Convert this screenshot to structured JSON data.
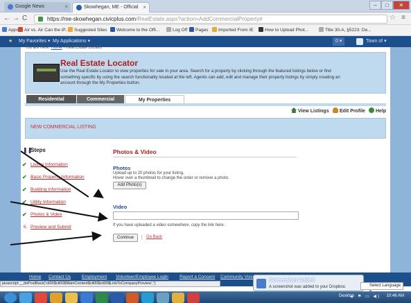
{
  "browser": {
    "tabs": [
      {
        "label": "Google News",
        "color": "#4a7bd0"
      },
      {
        "label": "Skowhegan, ME - Official",
        "color": "#2d5aa8"
      }
    ],
    "window_buttons": [
      "–",
      "□",
      "✕"
    ],
    "url_host": "https://me-skowhegan.civicplus.com",
    "url_path": "/RealEstate.aspx?action=AddCommercialProperty#",
    "bookmarks": [
      {
        "label": "Apps",
        "color": "#4a7bd0"
      },
      {
        "label": "Air vs. Air Can the iP...",
        "color": "#d04a2a"
      },
      {
        "label": "Suggested Sites",
        "color": "#f0a830"
      },
      {
        "label": "Welcome to the Offi...",
        "color": "#2d5aa8"
      },
      {
        "label": "Log Off",
        "color": "#888888"
      },
      {
        "label": "Pages",
        "color": "#2d5aa8"
      },
      {
        "label": "Imported From IE",
        "color": "#e0b030"
      },
      {
        "label": "How to Upload Phot...",
        "color": "#333333"
      },
      {
        "label": "Title 30-A, §5223: De...",
        "color": "#888888"
      }
    ]
  },
  "sitebar": {
    "favorites": "My Favorites ▾",
    "apps": "My Applications ▾",
    "town": "Town of ▾"
  },
  "breadcrumb": {
    "prefix": "You are here:",
    "home": "Home",
    "current": "› Real Estate Locator"
  },
  "header": {
    "title": "Real Estate Locator",
    "description": "Use the Real Estate Locator to view properties for sale in your area. Search for a property by clicking through the featured listings below or find something specific by using the search functionality located at the left. Agents can add, edit and manage their property listings by simply creating an account through the My Properties button."
  },
  "tabs": {
    "residential": "Residential",
    "commercial": "Commercial",
    "my_properties": "My Properties"
  },
  "toolbar": {
    "view_listings": "View Listings",
    "edit_profile": "Edit Profile",
    "help": "Help"
  },
  "listing_title": "NEW COMMERCIAL LISTING",
  "steps": {
    "heading": "Steps",
    "items": [
      {
        "label": "Listing Information",
        "state": "done"
      },
      {
        "label": "Basic Property Information",
        "state": "done"
      },
      {
        "label": "Building Information",
        "state": "done"
      },
      {
        "label": "Utility Information",
        "state": "done"
      },
      {
        "label": "Photos & Video",
        "state": "done"
      },
      {
        "label": "Preview and Submit",
        "state": "pending",
        "number": "6."
      }
    ]
  },
  "form": {
    "heading": "Photos & Video",
    "photos_title": "Photos",
    "photos_help1": "Upload up to 20 photos for your listing.",
    "photos_help2": "Hover over a thumbnail to change the order or remove a photo.",
    "add_photos": "Add Photo(s)",
    "video_title": "Video",
    "video_help": "If you have uploaded a video somewhere, copy the link here.",
    "continue": "Continue",
    "separator": "|",
    "go_back": "Go Back"
  },
  "footer": {
    "links": [
      "Home",
      "Contact Us",
      "Employment",
      "Volunteer/Employee Login",
      "Report a Concern",
      "Community Voice"
    ],
    "status_url": "javascript:__doPostBack('ctl00$ctl00$MainContent$ctl00$ctl00$LinkToCompanyPreview','')",
    "toast_title": "Screenshot Added",
    "toast_text": "A screenshot was added to your Dropbox.",
    "language": "Select Language ▾"
  },
  "taskbar": {
    "apps": [
      {
        "name": "start-button",
        "color": "#3a8fd8"
      },
      {
        "name": "ie",
        "color": "#4aa0e0"
      },
      {
        "name": "chrome",
        "color": "#e04a3a"
      },
      {
        "name": "media",
        "color": "#e0a030"
      },
      {
        "name": "explorer",
        "color": "#e8c050"
      },
      {
        "name": "outlook",
        "color": "#3a7ad0"
      },
      {
        "name": "excel",
        "color": "#2d8a4a"
      },
      {
        "name": "word",
        "color": "#2d5aa8"
      },
      {
        "name": "powerpoint",
        "color": "#d05a2a"
      },
      {
        "name": "ie2",
        "color": "#2a9ad0"
      },
      {
        "name": "fish",
        "color": "#6aa0c0"
      },
      {
        "name": "folder",
        "color": "#e0b040"
      },
      {
        "name": "paint",
        "color": "#d04040"
      }
    ],
    "desktop": "Desktop",
    "clock": "10:46 AM"
  }
}
